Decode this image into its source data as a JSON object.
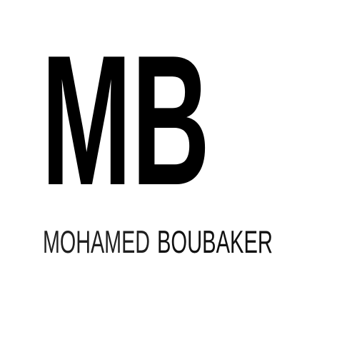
{
  "logo": {
    "monogram": "MB",
    "name_first": "MOHAMED",
    "name_last": "BOUBAKER"
  },
  "colors": {
    "background": "#ffffff",
    "monogram": "#000000",
    "name": "#1f1f1f"
  }
}
